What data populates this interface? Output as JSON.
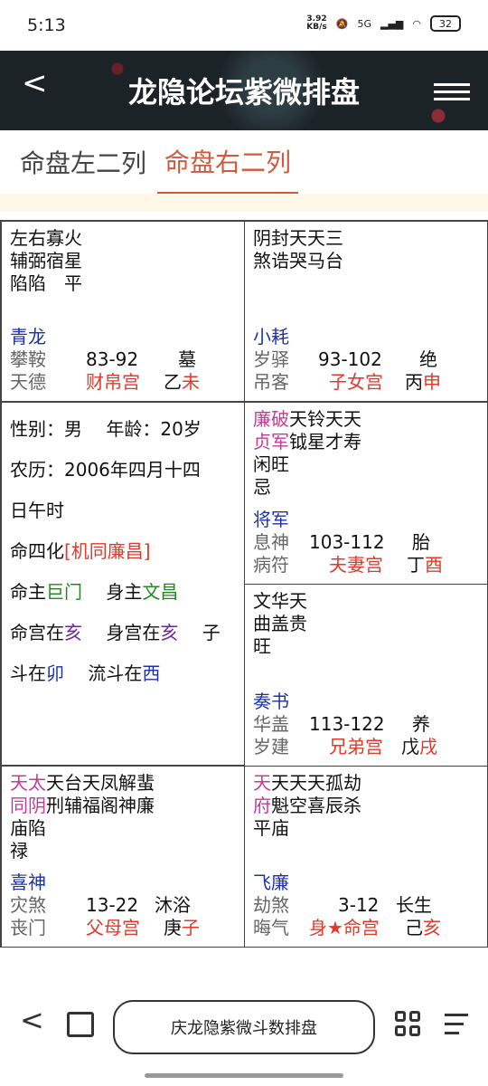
{
  "status": {
    "time": "5:13",
    "speed": "3.92\nKB/s",
    "net": "5G",
    "battery": "32"
  },
  "header": {
    "back": "<",
    "title": "龙隐论坛紫微排盘"
  },
  "tabs": [
    "命盘左二列",
    "命盘右二列"
  ],
  "cells": {
    "wei": {
      "stars1": "左右寡火",
      "stars2": "辅弼宿星",
      "stars3": "陷陷　平",
      "god": "青龙",
      "r1a": "攀鞍",
      "age": "83-92",
      "stage": "墓",
      "r2a": "天德",
      "palace": "财帛宫",
      "gan": "乙",
      "zhi": "未"
    },
    "shen": {
      "stars1": "阴封天天三",
      "stars2": "煞诰哭马台",
      "god": "小耗",
      "r1a": "岁驿",
      "age": "93-102",
      "stage": "绝",
      "r2a": "吊客",
      "palace": "子女宫",
      "gan": "丙",
      "zhi": "申"
    },
    "you": {
      "l1a": "廉破",
      "l1b": "天铃天天",
      "l2a": "贞军",
      "l2b": "钺星才寿",
      "l3": "闲旺",
      "l4": "忌",
      "god": "将军",
      "r1a": "息神",
      "age": "103-112",
      "stage": "胎",
      "r2a": "病符",
      "palace": "夫妻宫",
      "gan": "丁",
      "zhi": "酉"
    },
    "xu": {
      "stars1": "文华天",
      "stars2": "曲盖贵",
      "stars3": "旺",
      "god": "奏书",
      "r1a": "华盖",
      "age": "113-122",
      "stage": "养",
      "r2a": "岁建",
      "palace": "兄弟宫",
      "gan": "戊",
      "zhi": "戌"
    },
    "zi": {
      "l1a": "天太",
      "l1b": "天台天凤解蜚",
      "l2a": "同阴",
      "l2b": "刑辅福阁神廉",
      "l3": "庙陷",
      "l4": "禄",
      "god": "喜神",
      "r1a": "灾煞",
      "age": "13-22",
      "stage": "沐浴",
      "r2a": "丧门",
      "palace": "父母宫",
      "gan": "庚",
      "zhi": "子"
    },
    "hai": {
      "l1a": "天",
      "l1b": "天天天孤劫",
      "l2a": "府",
      "l2b": "魁空喜辰杀",
      "l3": "平庙",
      "god": "飞廉",
      "r1a": "劫煞",
      "age": "3-12",
      "stage": "长生",
      "r2a": "晦气",
      "palace": "身★命宫",
      "gan": "己",
      "zhi": "亥"
    }
  },
  "center": {
    "gender_label": "性别：",
    "gender": "男",
    "age_label": "年龄：",
    "age": "20岁",
    "lunar_label": "农历：",
    "lunar": "2006年四月十四",
    "hour": "日午时",
    "sihua_label": "命四化",
    "sihua": "[机同廉昌]",
    "ming_label": "命主",
    "ming": "巨门",
    "shen_label": "身主",
    "shen": "文昌",
    "mg_label": "命宫在",
    "mg": "亥",
    "sg_label": "身宫在",
    "sg": "亥",
    "zi": "子",
    "dou_label": "斗在",
    "dou": "卯",
    "ld_label": "流斗在",
    "ld": "西"
  },
  "navbar": {
    "back": "<",
    "search": "庆龙隐紫微斗数排盘"
  }
}
